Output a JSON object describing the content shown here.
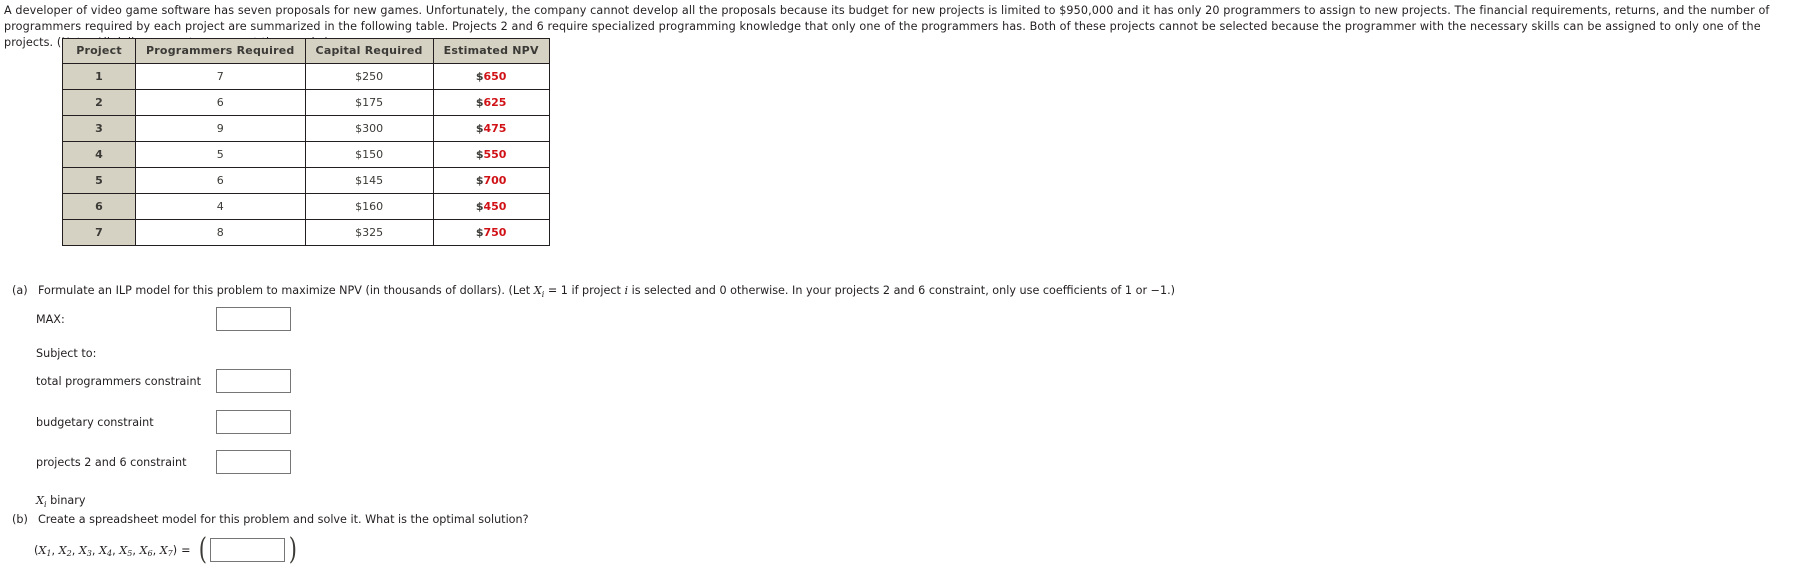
{
  "intro": {
    "paragraph": "A developer of video game software has seven proposals for new games. Unfortunately, the company cannot develop all the proposals because its budget for new projects is limited to $950,000 and it has only 20 programmers to assign to new projects. The financial requirements, returns, and the number of programmers required by each project are summarized in the following table. Projects 2 and 6 require specialized programming knowledge that only one of the programmers has. Both of these projects cannot be selected because the programmer with the necessary skills can be assigned to only one of the projects. (Note: All dollar amounts represent thousands.)"
  },
  "table": {
    "headers": [
      "Project",
      "Programmers Required",
      "Capital Required",
      "Estimated NPV"
    ],
    "rows": [
      {
        "project": "1",
        "programmers": "7",
        "capital": "$250",
        "npv_currency": "$",
        "npv_amount": "650"
      },
      {
        "project": "2",
        "programmers": "6",
        "capital": "$175",
        "npv_currency": "$",
        "npv_amount": "625"
      },
      {
        "project": "3",
        "programmers": "9",
        "capital": "$300",
        "npv_currency": "$",
        "npv_amount": "475"
      },
      {
        "project": "4",
        "programmers": "5",
        "capital": "$150",
        "npv_currency": "$",
        "npv_amount": "550"
      },
      {
        "project": "5",
        "programmers": "6",
        "capital": "$145",
        "npv_currency": "$",
        "npv_amount": "700"
      },
      {
        "project": "6",
        "programmers": "4",
        "capital": "$160",
        "npv_currency": "$",
        "npv_amount": "450"
      },
      {
        "project": "7",
        "programmers": "8",
        "capital": "$325",
        "npv_currency": "$",
        "npv_amount": "750"
      }
    ]
  },
  "part_a": {
    "label": "(a)",
    "text_1": "Formulate an ILP model for this problem to maximize NPV (in thousands of dollars). (Let ",
    "var_x": "X",
    "var_sub": "i",
    "text_2": " = 1 if project ",
    "var_i": "i",
    "text_3": " is selected and 0 otherwise. In your projects 2 and 6 constraint, only use coefficients of 1 or −1.)",
    "max_label": "MAX:",
    "subject_label": "Subject to:",
    "constraint_programmers_label": "total programmers constraint",
    "constraint_budget_label": "budgetary constraint",
    "constraint_p26_label": "projects 2 and 6 constraint",
    "binary_var": "X",
    "binary_sub": "i",
    "binary_text": " binary",
    "input_max_value": "",
    "input_programmers_value": "",
    "input_budget_value": "",
    "input_p26_value": "",
    "input_placeholder": ""
  },
  "part_b": {
    "label": "(b)",
    "text": "Create a spreadsheet model for this problem and solve it. What is the optimal solution?",
    "tuple_open": "(",
    "tuple_vars": [
      "X",
      "X",
      "X",
      "X",
      "X",
      "X",
      "X"
    ],
    "tuple_subs": [
      "1",
      "2",
      "3",
      "4",
      "5",
      "6",
      "7"
    ],
    "tuple_close": ")",
    "equals": "=",
    "input_solution_value": "",
    "input_placeholder": ""
  },
  "colors": {
    "text": "#231f20",
    "header_bg": "#d5d1c3",
    "npv_red": "#d01217",
    "border": "#231f20",
    "input_border": "#767676",
    "page_bg": "#ffffff"
  }
}
